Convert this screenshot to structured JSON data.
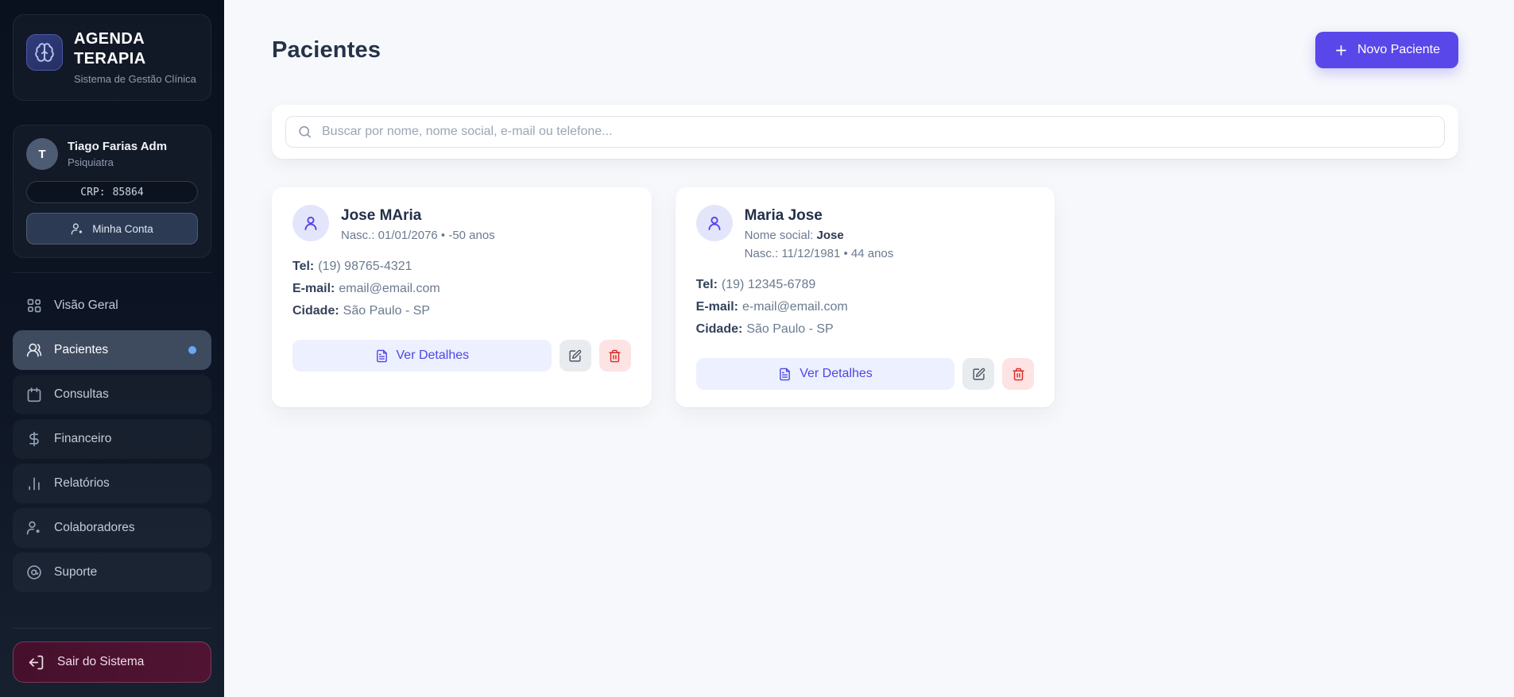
{
  "colors": {
    "accent": "#5a47ea",
    "accent_soft": "#edf0fe",
    "danger": "#dc2626",
    "danger_soft": "#fde3e3",
    "sidebar_bg": "#0d1524",
    "active_nav_bg": "#3e4a5e",
    "active_dot": "#69a7f8",
    "logout_bg": "#4a1230",
    "logout_text": "#eedbe6"
  },
  "sidebar": {
    "brand": {
      "title": "AGENDA TERAPIA",
      "subtitle": "Sistema de Gestão Clínica"
    },
    "user": {
      "initial": "T",
      "name": "Tiago Farias Adm",
      "role": "Psiquiatra",
      "crp_label": "CRP:",
      "crp_value": "85864",
      "account_button": "Minha Conta"
    },
    "nav": [
      {
        "label": "Visão Geral"
      },
      {
        "label": "Pacientes"
      },
      {
        "label": "Consultas"
      },
      {
        "label": "Financeiro"
      },
      {
        "label": "Relatórios"
      },
      {
        "label": "Colaboradores"
      },
      {
        "label": "Suporte"
      }
    ],
    "logout_label": "Sair do Sistema"
  },
  "header": {
    "title": "Pacientes",
    "new_patient_button": "Novo Paciente"
  },
  "search": {
    "placeholder": "Buscar por nome, nome social, e-mail ou telefone..."
  },
  "labels": {
    "social": "Nome social:",
    "tel": "Tel:",
    "email": "E-mail:",
    "city": "Cidade:",
    "details_button": "Ver Detalhes"
  },
  "patients": [
    {
      "name": "Jose MAria",
      "birth": "Nasc.: 01/01/2076 • -50 anos",
      "tel": "(19) 98765-4321",
      "email": "email@email.com",
      "city": "São Paulo - SP"
    },
    {
      "name": "Maria Jose",
      "social_name": "Jose",
      "birth": "Nasc.: 11/12/1981 • 44 anos",
      "tel": "(19) 12345-6789",
      "email": "e-mail@email.com",
      "city": "São Paulo - SP"
    }
  ]
}
